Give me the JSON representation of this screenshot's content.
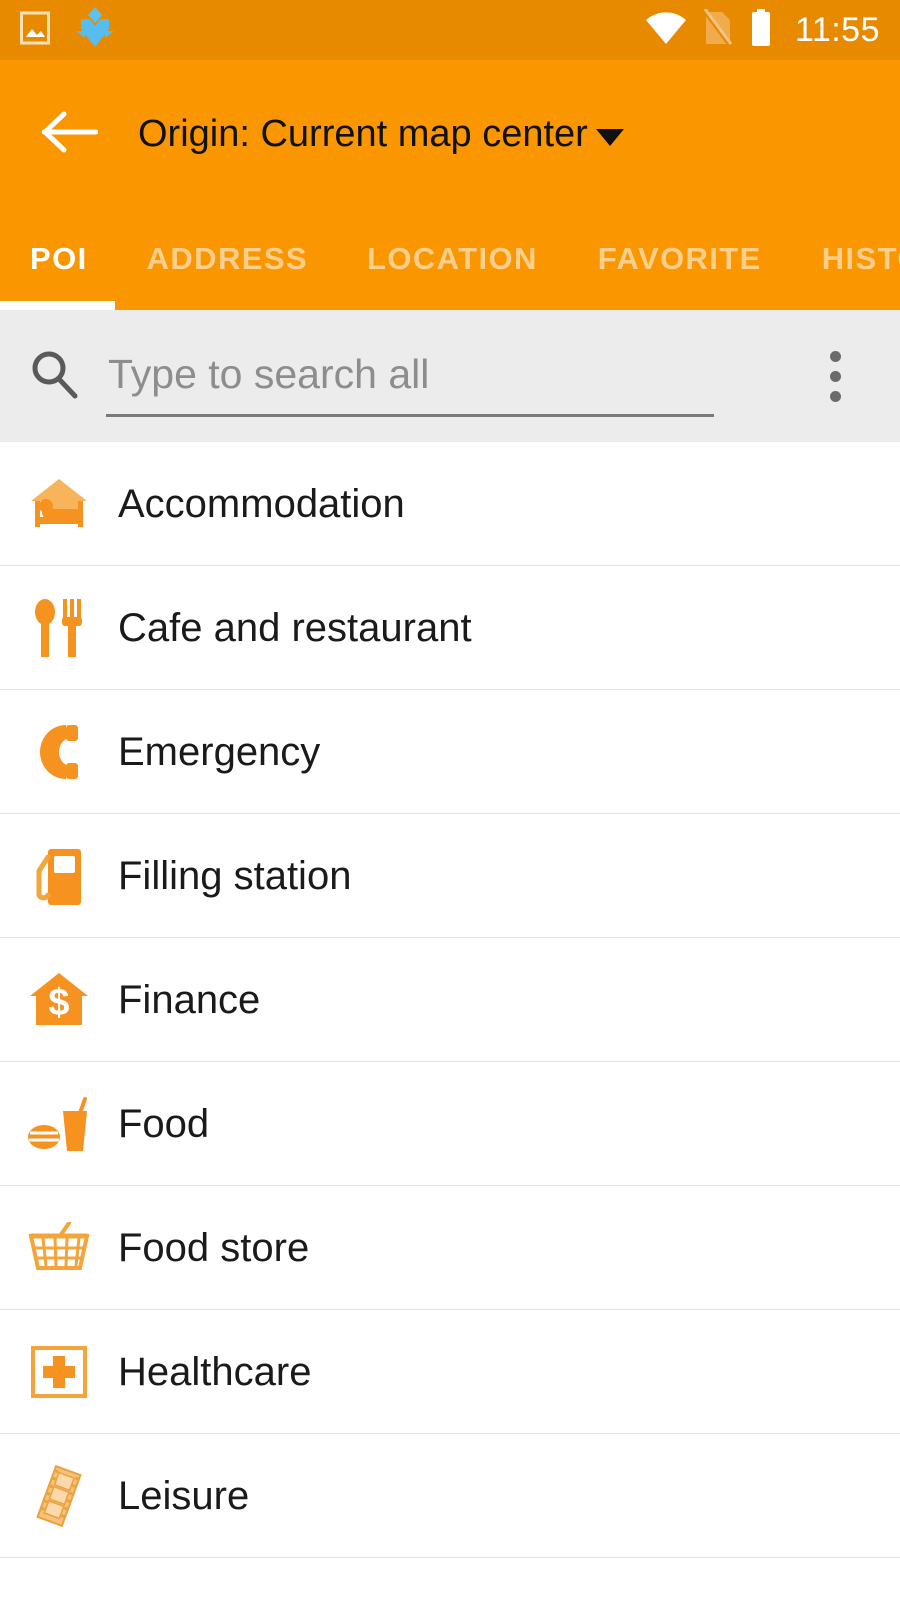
{
  "statusbar": {
    "time": "11:55",
    "icons": [
      {
        "name": "gallery-image-icon"
      },
      {
        "name": "download-arrow-icon"
      },
      {
        "name": "wifi-icon"
      },
      {
        "name": "sim-card-off-icon"
      },
      {
        "name": "battery-full-icon"
      }
    ]
  },
  "toolbar": {
    "back_icon": "back-arrow-icon",
    "origin_label": "Origin: Current map center",
    "dropdown_icon": "chevron-down-icon"
  },
  "tabs": {
    "active_index": 0,
    "items": [
      {
        "label": "POI"
      },
      {
        "label": "ADDRESS"
      },
      {
        "label": "LOCATION"
      },
      {
        "label": "FAVORITE"
      },
      {
        "label": "HISTO"
      }
    ]
  },
  "search": {
    "icon": "search-icon",
    "value": "",
    "placeholder": "Type to search all",
    "overflow_icon": "overflow-menu-icon"
  },
  "poi_list": [
    {
      "label": "Accommodation",
      "icon": "accommodation-icon"
    },
    {
      "label": "Cafe and restaurant",
      "icon": "cafe-restaurant-icon"
    },
    {
      "label": "Emergency",
      "icon": "emergency-phone-icon"
    },
    {
      "label": "Filling station",
      "icon": "filling-station-icon"
    },
    {
      "label": "Finance",
      "icon": "finance-bank-icon"
    },
    {
      "label": "Food",
      "icon": "food-icon"
    },
    {
      "label": "Food store",
      "icon": "food-store-basket-icon"
    },
    {
      "label": "Healthcare",
      "icon": "healthcare-cross-icon"
    },
    {
      "label": "Leisure",
      "icon": "leisure-film-icon"
    }
  ],
  "colors": {
    "status_bar": "#e78a00",
    "toolbar": "#fa9600",
    "accent_orange": "#f59220",
    "accent_orange_light": "#f8b45a",
    "search_bg": "#ececec",
    "divider": "#e3e3e3",
    "text_primary": "#1a1a1a"
  }
}
